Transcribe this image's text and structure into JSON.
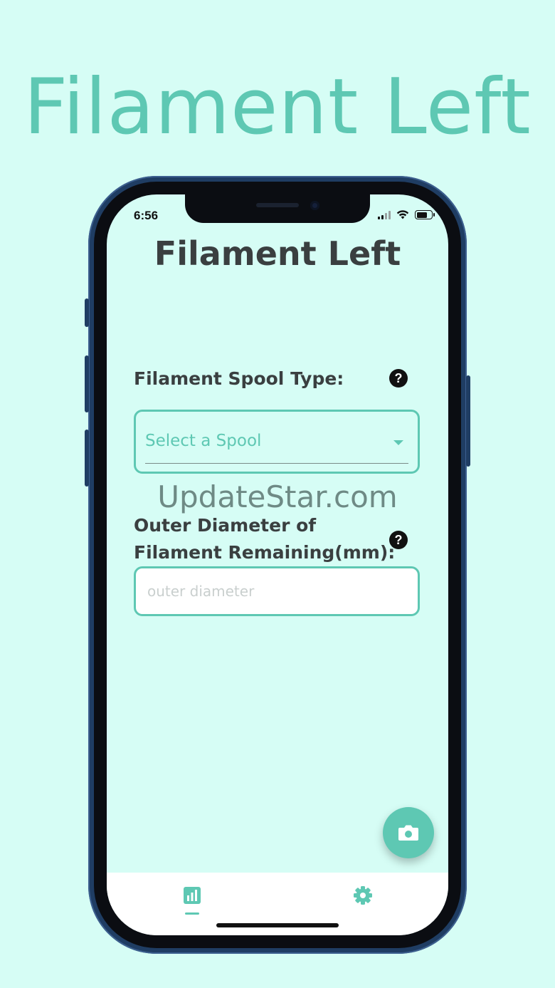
{
  "hero": {
    "title": "Filament Left"
  },
  "status_bar": {
    "time": "6:56",
    "battery_level": 0.7
  },
  "app": {
    "title": "Filament Left",
    "spool_type": {
      "label": "Filament Spool Type:",
      "help_icon": "question-circle-icon",
      "select_placeholder": "Select a Spool"
    },
    "watermark": "UpdateStar.com",
    "outer_diameter": {
      "label_line1": "Outer Diameter of",
      "label_line2": "Filament Remaining(mm):",
      "help_icon": "question-circle-icon",
      "placeholder": "outer diameter"
    },
    "fab_icon": "camera-icon",
    "tabs": [
      {
        "icon": "bar-chart-icon",
        "active": true
      },
      {
        "icon": "gear-icon",
        "active": false
      }
    ]
  },
  "colors": {
    "accent": "#5ec8b3",
    "background": "#d6fdf5",
    "text_dark": "#3a3f40",
    "phone_frame": "#1f3d63"
  }
}
